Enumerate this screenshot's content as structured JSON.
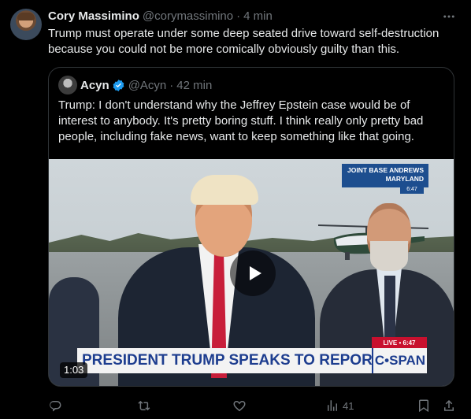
{
  "author": {
    "name": "Cory Massimino",
    "handle": "@corymassimino",
    "separator": "·",
    "time": "4 min"
  },
  "tweet_text": "Trump must operate under some deep seated drive toward self-destruction because you could not be more comically obviously guilty than this.",
  "quote": {
    "name": "Acyn",
    "handle": "@Acyn",
    "separator": "·",
    "time": "42 min",
    "text": "Trump: I don't understand why the Jeffrey Epstein case would be of interest to anybody. It's pretty boring stuff. I think really only pretty bad people, including fake news, want to keep something like that going.",
    "video": {
      "location_line1": "JOINT BASE ANDREWS",
      "location_line2": "MARYLAND",
      "location_time": "6:47",
      "live_label": "LIVE • 6:47",
      "headline": "PRESIDENT TRUMP SPEAKS TO REPORTERS",
      "network": "C•SPAN",
      "duration": "1:03"
    }
  },
  "actions": {
    "views_count": "41"
  },
  "colors": {
    "background": "#000000",
    "text": "#e7e9ea",
    "muted": "#71767b",
    "verified": "#1d9bf0"
  }
}
